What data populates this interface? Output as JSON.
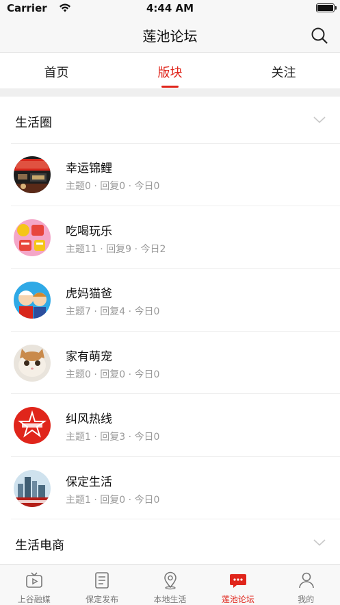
{
  "status_bar": {
    "carrier": "Carrier",
    "time": "4:44 AM"
  },
  "nav": {
    "title": "莲池论坛",
    "search_icon": "search-icon"
  },
  "tabs": [
    {
      "label": "首页",
      "active": false
    },
    {
      "label": "版块",
      "active": true
    },
    {
      "label": "关注",
      "active": false
    }
  ],
  "sections": [
    {
      "label": "生活圈",
      "expanded": true
    },
    {
      "label": "生活电商",
      "expanded": false
    }
  ],
  "forums": [
    {
      "name": "幸运锦鲤",
      "topics": "主题0",
      "replies": "回复0",
      "today": "今日0",
      "avatar": "lottery-avatar"
    },
    {
      "name": "吃喝玩乐",
      "topics": "主题11",
      "replies": "回复9",
      "today": "今日2",
      "avatar": "food-fun-avatar"
    },
    {
      "name": "虎妈猫爸",
      "topics": "主题7",
      "replies": "回复4",
      "today": "今日0",
      "avatar": "parents-cartoon-avatar"
    },
    {
      "name": "家有萌宠",
      "topics": "主题0",
      "replies": "回复0",
      "today": "今日0",
      "avatar": "cat-photo-avatar"
    },
    {
      "name": "纠风热线",
      "topics": "主题1",
      "replies": "回复3",
      "today": "今日0",
      "avatar": "hotline-logo-avatar"
    },
    {
      "name": "保定生活",
      "topics": "主题1",
      "replies": "回复0",
      "today": "今日0",
      "avatar": "city-skyline-avatar"
    }
  ],
  "separator": "·",
  "tab_bar": [
    {
      "label": "上谷融媒",
      "icon": "tv-icon",
      "active": false
    },
    {
      "label": "保定发布",
      "icon": "document-list-icon",
      "active": false
    },
    {
      "label": "本地生活",
      "icon": "location-pin-icon",
      "active": false
    },
    {
      "label": "莲池论坛",
      "icon": "chat-bubble-icon",
      "active": true
    },
    {
      "label": "我的",
      "icon": "person-icon",
      "active": false
    }
  ],
  "colors": {
    "accent": "#e0251b",
    "muted_text": "#999999",
    "bar_background": "#f7f7f7"
  }
}
